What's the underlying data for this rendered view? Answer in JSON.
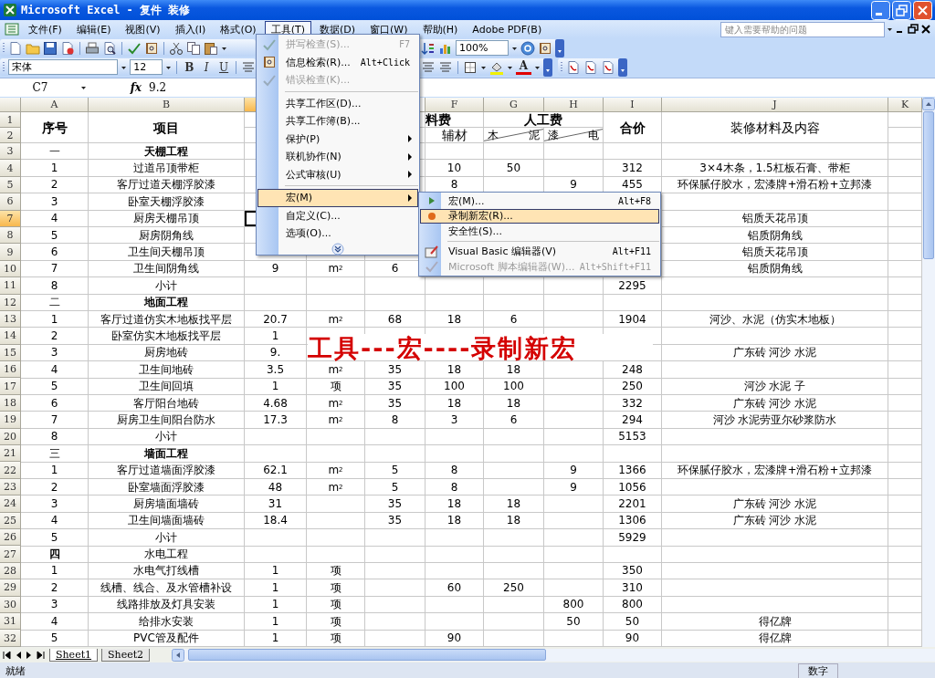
{
  "window": {
    "title": "Microsoft Excel - 复件 装修"
  },
  "menu_bar": {
    "items": [
      {
        "label": "文件(F)",
        "selected": false
      },
      {
        "label": "编辑(E)",
        "selected": false
      },
      {
        "label": "视图(V)",
        "selected": false
      },
      {
        "label": "插入(I)",
        "selected": false
      },
      {
        "label": "格式(O)",
        "selected": false
      },
      {
        "label": "工具(T)",
        "selected": true
      },
      {
        "label": "数据(D)",
        "selected": false
      },
      {
        "label": "窗口(W)",
        "selected": false
      },
      {
        "label": "帮助(H)",
        "selected": false
      },
      {
        "label": "Adobe PDF(B)",
        "selected": false
      }
    ],
    "help_placeholder": "键入需要帮助的问题"
  },
  "standard_toolbar": {
    "zoom": "100%"
  },
  "format_toolbar": {
    "font": "宋体",
    "size": "12",
    "style_buttons": [
      "B",
      "I",
      "U"
    ],
    "font_color": "A"
  },
  "formula_bar": {
    "name_box": "C7",
    "function_label": "fx",
    "value": "9.2"
  },
  "grid": {
    "columns": {
      "A": {
        "label": "A",
        "selected": false
      },
      "B": {
        "label": "B",
        "selected": false
      },
      "C": {
        "selected": true
      },
      "F": {
        "label": "F",
        "selected": false
      },
      "G": {
        "label": "G",
        "selected": false
      },
      "H": {
        "label": "H",
        "selected": false
      },
      "I": {
        "label": "I",
        "selected": false
      },
      "J": {
        "label": "J",
        "selected": false
      },
      "K": {
        "label": "K",
        "selected": false
      }
    },
    "header": {
      "row_labels": [
        "1",
        "2"
      ],
      "A": {
        "text": "序号",
        "bold": true
      },
      "B": {
        "text": "项目",
        "bold": true
      },
      "F1": {
        "text": "料费",
        "bold": true
      },
      "G1": {
        "text": "人工费",
        "bold": true
      },
      "F2": "辅材",
      "G2": {
        "left": "木",
        "right": "泥"
      },
      "H2": {
        "left": "漆",
        "right": "电"
      },
      "I": {
        "text": "合价",
        "bold": true
      },
      "J": "装修材料及内容"
    },
    "rows": [
      {
        "num": "3",
        "selected": false,
        "cells": {
          "A": "一",
          "B": {
            "text": "天棚工程",
            "bold": true
          }
        }
      },
      {
        "num": "4",
        "selected": false,
        "cells": {
          "A": "1",
          "B": "过道吊顶带柜",
          "F": "10",
          "G": "50",
          "I": "312",
          "J": "3×4木条，1.5杠板石膏、带柜"
        }
      },
      {
        "num": "5",
        "selected": false,
        "cells": {
          "A": "2",
          "B": "客厅过道天棚浮胶漆",
          "F": "8",
          "H": "9",
          "I": "455",
          "J": "环保腻仔胶水，宏漆牌+滑石粉+立邦漆"
        }
      },
      {
        "num": "6",
        "selected": false,
        "cells": {
          "A": "3",
          "B": "卧室天棚浮胶漆"
        }
      },
      {
        "num": "7",
        "selected": true,
        "cells": {
          "A": "4",
          "B": "厨房天棚吊顶",
          "C": {
            "active": true
          },
          "J": "铝质天花吊顶"
        }
      },
      {
        "num": "8",
        "selected": false,
        "cells": {
          "A": "5",
          "B": "厨房阴角线",
          "J": "铝质阴角线"
        }
      },
      {
        "num": "9",
        "selected": false,
        "cells": {
          "A": "6",
          "B": "卫生间天棚吊顶",
          "J": "铝质天花吊顶"
        }
      },
      {
        "num": "10",
        "selected": false,
        "cells": {
          "A": "7",
          "B": "卫生间阴角线",
          "C": "9",
          "D": "m$^{2}$",
          "E": "6",
          "J": "铝质阴角线"
        }
      },
      {
        "num": "11",
        "selected": false,
        "cells": {
          "A": "8",
          "B": "小计",
          "I": "2295"
        }
      },
      {
        "num": "12",
        "selected": false,
        "cells": {
          "A": "二",
          "B": {
            "text": "地面工程",
            "bold": true
          }
        }
      },
      {
        "num": "13",
        "selected": false,
        "cells": {
          "A": "1",
          "B": "客厅过道仿实木地板找平层",
          "C": "20.7",
          "D": "m$^{2}$",
          "E": "68",
          "F": "18",
          "G": "6",
          "I": "1904",
          "J": "河沙、水泥（仿实木地板）"
        }
      },
      {
        "num": "14",
        "selected": false,
        "cells": {
          "A": "2",
          "B": "卧室仿实木地板找平层",
          "C": "1"
        }
      },
      {
        "num": "15",
        "selected": false,
        "cells": {
          "A": "3",
          "B": "厨房地砖",
          "C": "9.",
          "J": "广东砖 河沙 水泥"
        }
      },
      {
        "num": "16",
        "selected": false,
        "cells": {
          "A": "4",
          "B": "卫生间地砖",
          "C": "3.5",
          "D": "m$^{2}$",
          "E": "35",
          "F": "18",
          "G": "18",
          "I": "248"
        }
      },
      {
        "num": "17",
        "selected": false,
        "cells": {
          "A": "5",
          "B": "卫生间回填",
          "C": "1",
          "D": "项",
          "E": "35",
          "F": "100",
          "G": "100",
          "I": "250",
          "J": "河沙 水泥  子"
        }
      },
      {
        "num": "18",
        "selected": false,
        "cells": {
          "A": "6",
          "B": "客厅阳台地砖",
          "C": "4.68",
          "D": "m$^{2}$",
          "E": "35",
          "F": "18",
          "G": "18",
          "I": "332",
          "J": "广东砖 河沙 水泥"
        }
      },
      {
        "num": "19",
        "selected": false,
        "cells": {
          "A": "7",
          "B": "厨房卫生间阳台防水",
          "C": "17.3",
          "D": "m$^{2}$",
          "E": "8",
          "F": "3",
          "G": "6",
          "I": "294",
          "J": "河沙 水泥劳亚尔砂浆防水"
        }
      },
      {
        "num": "20",
        "selected": false,
        "cells": {
          "A": "8",
          "B": "小计",
          "I": "5153"
        }
      },
      {
        "num": "21",
        "selected": false,
        "cells": {
          "A": "三",
          "B": {
            "text": "墙面工程",
            "bold": true
          }
        }
      },
      {
        "num": "22",
        "selected": false,
        "cells": {
          "A": "1",
          "B": "客厅过道墙面浮胶漆",
          "C": "62.1",
          "D": "m$^{2}$",
          "E": "5",
          "F": "8",
          "H": "9",
          "I": "1366",
          "J": "环保腻仔胶水，宏漆牌+滑石粉+立邦漆"
        }
      },
      {
        "num": "23",
        "selected": false,
        "cells": {
          "A": "2",
          "B": "卧室墙面浮胶漆",
          "C": "48",
          "D": "m$^{2}$",
          "E": "5",
          "F": "8",
          "H": "9",
          "I": "1056"
        }
      },
      {
        "num": "24",
        "selected": false,
        "cells": {
          "A": "3",
          "B": "厨房墙面墙砖",
          "C": "31",
          "E": "35",
          "F": "18",
          "G": "18",
          "I": "2201",
          "J": "广东砖 河沙 水泥"
        }
      },
      {
        "num": "25",
        "selected": false,
        "cells": {
          "A": "4",
          "B": "卫生间墙面墙砖",
          "C": "18.4",
          "E": "35",
          "F": "18",
          "G": "18",
          "I": "1306",
          "J": "广东砖 河沙 水泥"
        }
      },
      {
        "num": "26",
        "selected": false,
        "cells": {
          "A": "5",
          "B": "小计",
          "I": "5929"
        }
      },
      {
        "num": "27",
        "selected": false,
        "cells": {
          "A": {
            "text": "四",
            "bold": true
          },
          "B": "水电工程"
        }
      },
      {
        "num": "28",
        "selected": false,
        "cells": {
          "A": "1",
          "B": "水电气打线槽",
          "C": "1",
          "D": "项",
          "I": "350"
        }
      },
      {
        "num": "29",
        "selected": false,
        "cells": {
          "A": "2",
          "B": "线槽、线合、及水管槽补设",
          "C": "1",
          "D": "项",
          "F": "60",
          "G": "250",
          "I": "310"
        }
      },
      {
        "num": "30",
        "selected": false,
        "cells": {
          "A": "3",
          "B": "线路排放及灯具安装",
          "C": "1",
          "D": "项",
          "H": "800",
          "I": "800"
        }
      },
      {
        "num": "31",
        "selected": false,
        "cells": {
          "A": "4",
          "B": "给排水安装",
          "C": "1",
          "D": "项",
          "H": "50",
          "I": "50",
          "J": "得亿牌"
        }
      },
      {
        "num": "32",
        "selected": false,
        "cells": {
          "A": "5",
          "B": "PVC管及配件",
          "C": "1",
          "D": "项",
          "F": "90",
          "I": "90",
          "J": "得亿牌"
        }
      }
    ]
  },
  "annotation": {
    "text": "工具---宏----录制新宏"
  },
  "tools_menu": {
    "items": [
      {
        "kind": "item",
        "label": "拼写检查(S)...",
        "shortcut": "F7",
        "disabled": true,
        "selected": false
      },
      {
        "kind": "item",
        "label": "信息检索(R)...",
        "shortcut": "Alt+Click",
        "disabled": false,
        "selected": false
      },
      {
        "kind": "item",
        "label": "错误检查(K)...",
        "disabled": true,
        "selected": false
      },
      {
        "kind": "separator"
      },
      {
        "kind": "item",
        "label": "共享工作区(D)...",
        "disabled": false,
        "selected": false
      },
      {
        "kind": "item",
        "label": "共享工作簿(B)...",
        "disabled": false,
        "selected": false
      },
      {
        "kind": "submenu",
        "label": "保护(P)",
        "disabled": false,
        "selected": false
      },
      {
        "kind": "submenu",
        "label": "联机协作(N)",
        "disabled": false,
        "selected": false
      },
      {
        "kind": "submenu",
        "label": "公式审核(U)",
        "disabled": false,
        "selected": false
      },
      {
        "kind": "separator"
      },
      {
        "kind": "submenu",
        "label": "宏(M)",
        "disabled": false,
        "selected": true
      },
      {
        "kind": "item",
        "label": "自定义(C)...",
        "disabled": false,
        "selected": false
      },
      {
        "kind": "item",
        "label": "选项(O)...",
        "disabled": false,
        "selected": false
      }
    ]
  },
  "macro_submenu": {
    "items": [
      {
        "kind": "item",
        "label": "宏(M)...",
        "shortcut": "Alt+F8",
        "disabled": false,
        "selected": false
      },
      {
        "kind": "item",
        "label": "录制新宏(R)...",
        "disabled": false,
        "selected": true
      },
      {
        "kind": "item",
        "label": "安全性(S)...",
        "disabled": false,
        "selected": false
      },
      {
        "kind": "separator"
      },
      {
        "kind": "item",
        "label": "Visual Basic 编辑器(V)",
        "shortcut": "Alt+F11",
        "disabled": false,
        "selected": false
      },
      {
        "kind": "item",
        "label": "Microsoft 脚本编辑器(W)...",
        "shortcut": "Alt+Shift+F11",
        "disabled": true,
        "selected": false
      }
    ]
  },
  "sheet_tabs": [
    {
      "label": "Sheet1",
      "selected": true
    },
    {
      "label": "Sheet2",
      "selected": false
    }
  ],
  "status_bar": {
    "left": "就绪",
    "mode": "数字"
  }
}
